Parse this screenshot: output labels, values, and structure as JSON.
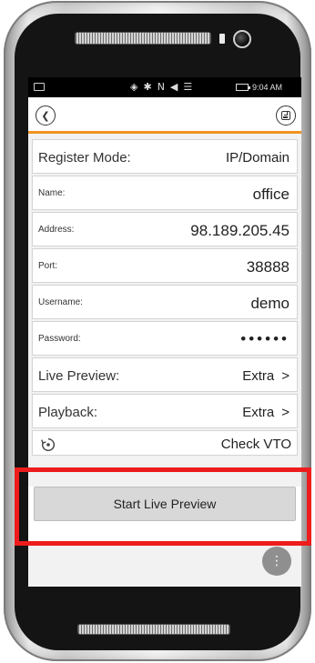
{
  "statusbar": {
    "icons": [
      "◈",
      "✱",
      "N",
      "◀",
      "☰"
    ],
    "time": "9:04 AM"
  },
  "navbar": {
    "back_icon": "chevron-left-icon",
    "save_icon": "save-icon",
    "accent_color": "#f0931f"
  },
  "form": {
    "register_mode": {
      "label": "Register Mode:",
      "value": "IP/Domain"
    },
    "name": {
      "label": "Name:",
      "value": "office"
    },
    "address": {
      "label": "Address:",
      "value": "98.189.205.45"
    },
    "port": {
      "label": "Port:",
      "value": "38888"
    },
    "username": {
      "label": "Username:",
      "value": "demo"
    },
    "password": {
      "label": "Password:",
      "value": "••••••"
    },
    "live_preview": {
      "label": "Live Preview:",
      "value": "Extra",
      "chevron": ">"
    },
    "playback": {
      "label": "Playback:",
      "value": "Extra",
      "chevron": ">"
    },
    "check_vto": {
      "label": "Check VTO"
    }
  },
  "actions": {
    "start_live_preview": "Start Live Preview",
    "fab_glyph": "⋮"
  },
  "colors": {
    "highlight": "#ee1c1c"
  }
}
